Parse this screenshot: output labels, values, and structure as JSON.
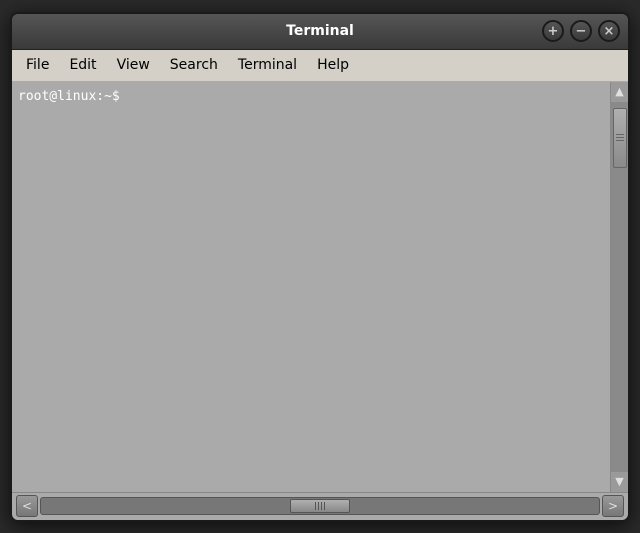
{
  "window": {
    "title": "Terminal",
    "controls": {
      "add": "+",
      "minimize": "−",
      "close": "×"
    }
  },
  "menubar": {
    "items": [
      "File",
      "Edit",
      "View",
      "Search",
      "Terminal",
      "Help"
    ]
  },
  "terminal": {
    "prompt": "root@linux:~$"
  },
  "scrollbar": {
    "up_arrow": "▲",
    "down_arrow": "▼",
    "left_arrow": "<",
    "right_arrow": ">"
  }
}
